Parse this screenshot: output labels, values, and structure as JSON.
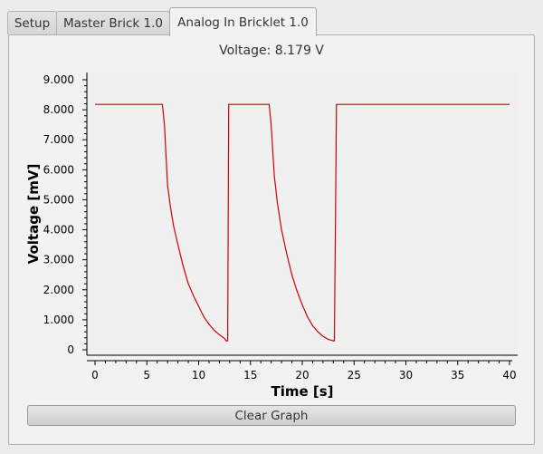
{
  "tabs": [
    {
      "label": "Setup"
    },
    {
      "label": "Master Brick 1.0"
    },
    {
      "label": "Analog In Bricklet 1.0"
    }
  ],
  "active_tab": 2,
  "voltage_readout": "Voltage: 8.179 V",
  "clear_button_label": "Clear Graph",
  "colors": {
    "line": "#d40000",
    "plot_bg": "#f0f0f0",
    "accent_text": "#000000"
  },
  "chart_data": {
    "type": "line",
    "title": "",
    "xlabel": "Time [s]",
    "ylabel": "Voltage [mV]",
    "xlim": [
      0,
      40
    ],
    "ylim": [
      0,
      9000
    ],
    "x_ticks": [
      0,
      5,
      10,
      15,
      20,
      25,
      30,
      35,
      40
    ],
    "y_ticks": [
      0,
      1000,
      2000,
      3000,
      4000,
      5000,
      6000,
      7000,
      8000,
      9000
    ],
    "x_tick_labels": [
      "0",
      "5",
      "10",
      "15",
      "20",
      "25",
      "30",
      "35",
      "40"
    ],
    "y_tick_labels": [
      "0",
      "1.000",
      "2.000",
      "3.000",
      "4.000",
      "5.000",
      "6.000",
      "7.000",
      "8.000",
      "9.000"
    ],
    "grid": false,
    "legend": "none",
    "series": [
      {
        "x": [
          0,
          6.5,
          6.7,
          7.0,
          7.3,
          7.6,
          8.0,
          8.5,
          9.0,
          9.5,
          10.0,
          10.5,
          11.0,
          11.5,
          12.0,
          12.5,
          12.65,
          12.8,
          12.9,
          13.5,
          16.8,
          17.0,
          17.3,
          17.6,
          18.0,
          18.5,
          19.0,
          19.5,
          20.0,
          20.5,
          21.0,
          21.5,
          22.0,
          22.5,
          23.0,
          23.1,
          23.3,
          23.5,
          40
        ],
        "y": [
          8179,
          8179,
          7500,
          5500,
          4700,
          4100,
          3500,
          2800,
          2200,
          1800,
          1450,
          1100,
          850,
          650,
          500,
          380,
          300,
          300,
          8179,
          8179,
          8179,
          7500,
          5800,
          4900,
          4000,
          3200,
          2500,
          1950,
          1500,
          1100,
          800,
          600,
          450,
          350,
          300,
          300,
          8179,
          8179,
          8179
        ]
      }
    ]
  }
}
